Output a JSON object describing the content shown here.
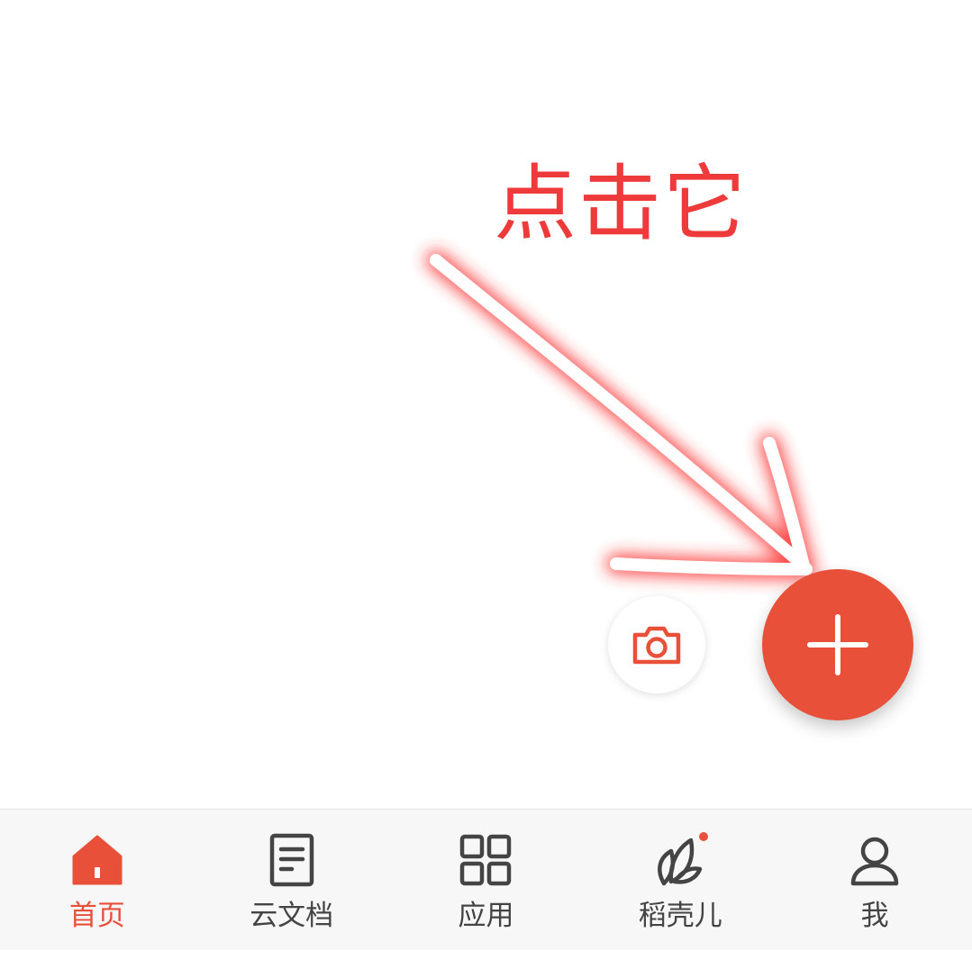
{
  "annotation": {
    "text": "点击它"
  },
  "actions": {
    "camera_icon": "camera-icon",
    "add_icon": "plus-icon"
  },
  "bottom_nav": {
    "items": [
      {
        "label": "首页",
        "icon": "home-icon",
        "active": true
      },
      {
        "label": "云文档",
        "icon": "document-icon",
        "active": false
      },
      {
        "label": "应用",
        "icon": "apps-grid-icon",
        "active": false
      },
      {
        "label": "稻壳儿",
        "icon": "leaf-icon",
        "active": false,
        "badge": true
      },
      {
        "label": "我",
        "icon": "user-icon",
        "active": false
      }
    ]
  },
  "colors": {
    "accent": "#e8503a",
    "annotation": "#ee3a3a",
    "nav_text": "#444444",
    "nav_background": "#f7f7f7"
  }
}
